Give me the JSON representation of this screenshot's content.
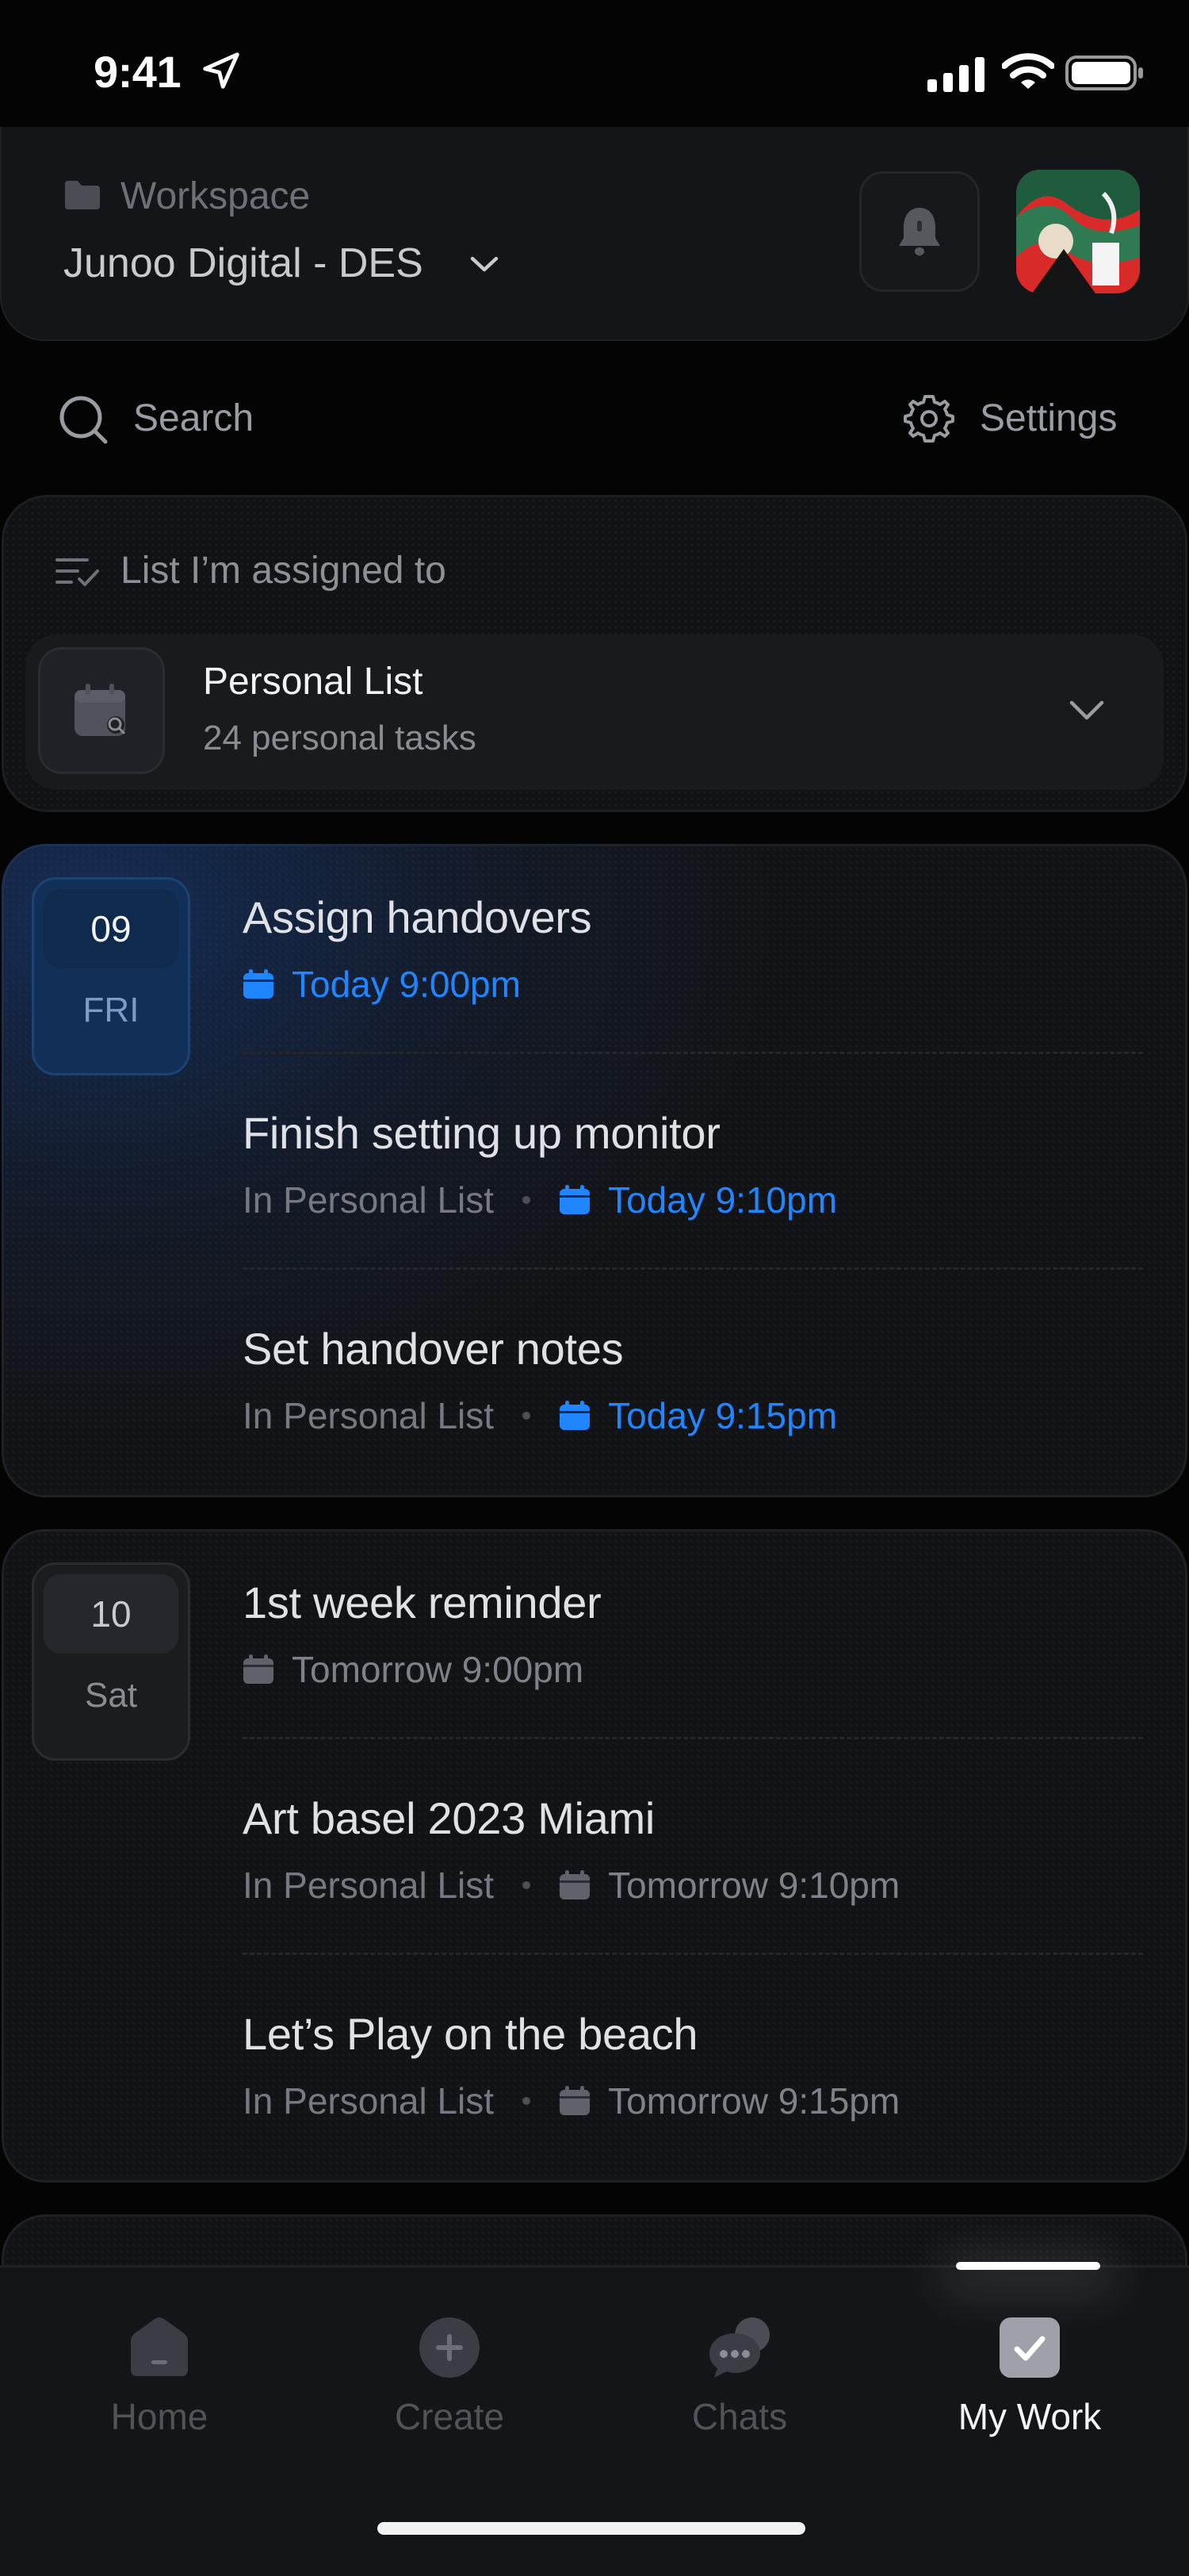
{
  "status_bar": {
    "time": "9:41"
  },
  "header": {
    "workspace_label": "Workspace",
    "workspace_name": "Junoo Digital - DES"
  },
  "toolbar": {
    "search_label": "Search",
    "settings_label": "Settings"
  },
  "list_section": {
    "heading": "List I’m assigned to",
    "selected_list": {
      "title": "Personal List",
      "subtitle": "24 personal tasks"
    }
  },
  "day_groups": [
    {
      "day": "09",
      "weekday": "FRI",
      "tasks": [
        {
          "title": "Assign handovers",
          "list": "",
          "due": "Today 9:00pm"
        },
        {
          "title": "Finish setting up monitor",
          "list": "In Personal List",
          "due": "Today 9:10pm"
        },
        {
          "title": "Set handover notes",
          "list": "In Personal List",
          "due": "Today 9:15pm"
        }
      ]
    },
    {
      "day": "10",
      "weekday": "Sat",
      "tasks": [
        {
          "title": "1st week reminder",
          "list": "",
          "due": "Tomorrow 9:00pm"
        },
        {
          "title": "Art basel 2023 Miami",
          "list": "In Personal List",
          "due": "Tomorrow 9:10pm"
        },
        {
          "title": "Let’s Play on the beach",
          "list": "In Personal List",
          "due": "Tomorrow 9:15pm"
        }
      ]
    }
  ],
  "bottom_nav": {
    "items": [
      {
        "label": "Home",
        "icon": "home-icon"
      },
      {
        "label": "Create",
        "icon": "plus-circle-icon"
      },
      {
        "label": "Chats",
        "icon": "chat-bubbles-icon"
      },
      {
        "label": "My Work",
        "icon": "checkbox-icon",
        "active": true
      }
    ]
  },
  "colors": {
    "background": "#040405",
    "accent_blue": "#1f86ff",
    "card": "#121316"
  }
}
